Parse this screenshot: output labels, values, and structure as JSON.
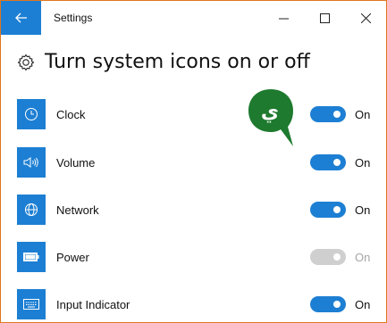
{
  "window": {
    "title": "Settings",
    "controls": {
      "minimize": "—",
      "maximize": "☐",
      "close": "✕"
    }
  },
  "page": {
    "title": "Turn system icons on or off"
  },
  "items": [
    {
      "label": "Clock",
      "state": "On",
      "enabled": true,
      "icon": "clock-icon"
    },
    {
      "label": "Volume",
      "state": "On",
      "enabled": true,
      "icon": "volume-icon"
    },
    {
      "label": "Network",
      "state": "On",
      "enabled": true,
      "icon": "globe-icon"
    },
    {
      "label": "Power",
      "state": "On",
      "enabled": false,
      "icon": "battery-icon"
    },
    {
      "label": "Input Indicator",
      "state": "On",
      "enabled": true,
      "icon": "keyboard-icon"
    }
  ],
  "badge": {
    "glyph": "ي"
  },
  "colors": {
    "accent": "#1d7fd3",
    "window_border": "#e0771e",
    "toggle_disabled": "#cfcfcf",
    "badge": "#1e7a2e"
  }
}
